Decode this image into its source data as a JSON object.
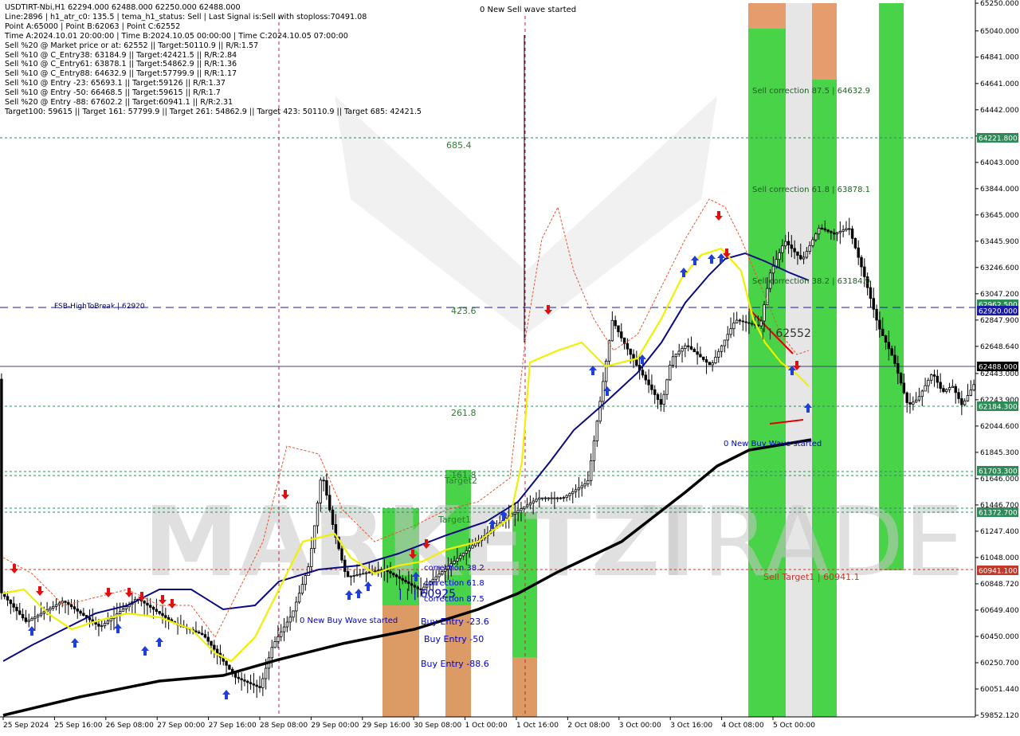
{
  "info": {
    "lines": [
      "USDTIRT-Nbi,H1  62294.000 62488.000 62250.000 62488.000",
      "Line:2896 | h1_atr_c0: 135.5 | tema_h1_status: Sell | Last Signal is:Sell with stoploss:70491.08",
      "Point A:65000 | Point B:62063 | Point C:62552",
      "Time A:2024.10.01 20:00:00 | Time B:2024.10.05 00:00:00 | Time C:2024.10.05 07:00:00",
      "Sell %20 @ Market price or at: 62552 || Target:50110.9 || R/R:1.57",
      "Sell %10 @ C_Entry38: 63184.9 || Target:42421.5 || R/R:2.84",
      "Sell %10 @ C_Entry61: 63878.1 || Target:54862.9 || R/R:1.36",
      "Sell %10 @ C_Entry88: 64632.9 || Target:57799.9 || R/R:1.17",
      "Sell %10 @ Entry -23: 65693.1 || Target:59126 || R/R:1.37",
      "Sell %10 @ Entry -50: 66468.5 || Target:59615 || R/R:1.7",
      "Sell %20 @ Entry -88: 67602.2 || Target:60941.1 || R/R:2.31",
      "Target100: 59615 || Target 161: 57799.9 || Target 261: 54862.9 || Target 423: 50110.9 || Target 685: 42421.5"
    ]
  },
  "watermark": {
    "left": "MARKETZI",
    "right": "TRADE"
  },
  "chart_data": {
    "type": "line",
    "symbol": "USDTIRT-Nbi",
    "timeframe": "H1",
    "ylim": [
      59852.12,
      65250.0
    ],
    "y_ticks": [
      "65250.000",
      "65040.000",
      "64841.000",
      "64641.000",
      "64442.000",
      "64243.000",
      "64043.000",
      "63844.000",
      "63645.000",
      "63445.900",
      "63246.600",
      "63047.200",
      "62847.900",
      "62648.640",
      "62443.000",
      "62243.900",
      "62044.600",
      "61845.300",
      "61646.000",
      "61446.700",
      "61247.400",
      "61048.000",
      "60848.720",
      "60649.400",
      "60450.000",
      "60250.700",
      "60051.440",
      "59852.120"
    ],
    "x_labels": [
      "25 Sep 2024",
      "25 Sep 16:00",
      "26 Sep 08:00",
      "27 Sep 00:00",
      "27 Sep 16:00",
      "28 Sep 08:00",
      "29 Sep 00:00",
      "29 Sep 16:00",
      "30 Sep 08:00",
      "1 Oct 00:00",
      "1 Oct 16:00",
      "2 Oct 08:00",
      "3 Oct 00:00",
      "3 Oct 16:00",
      "4 Oct 08:00",
      "5 Oct 00:00"
    ],
    "price_labels": [
      {
        "text": "64221.800",
        "color": "#2e8b57"
      },
      {
        "text": "62962.500",
        "color": "#2e8b57"
      },
      {
        "text": "62920.000",
        "color": "#1a1aa6"
      },
      {
        "text": "62488.000",
        "color": "#000000"
      },
      {
        "text": "62184.300",
        "color": "#2e8b57"
      },
      {
        "text": "61703.300",
        "color": "#2e8b57"
      },
      {
        "text": "61372.700",
        "color": "#2e8b57"
      },
      {
        "text": "60941.100",
        "color": "#c0392b"
      }
    ],
    "annotations": [
      "0 New Sell wave started",
      "685.4",
      "423.6",
      "261.8",
      "161.8",
      "Target2",
      "Target1",
      "FSB-HighToBreak | 62920",
      "Sell correction 87.5 | 64632.9",
      "Sell correction 61.8 | 63878.1",
      "Sell correction 38.2 | 63184.9",
      "| | 62552",
      "0 New Buy Wave started",
      "0 New Buy Wave started",
      "Sell Target1 | 60941.1",
      "correction 38.2",
      "correction 61.8",
      "correction 87.5",
      "| | | 60925",
      "Buy Entry -23.6",
      "Buy Entry -50",
      "Buy Entry -88.6"
    ],
    "series": [
      {
        "name": "",
        "color": "#000000"
      },
      {
        "name": "",
        "color": "#0a0a80"
      },
      {
        "name": "",
        "color": "#f0f000"
      },
      {
        "name": "",
        "color": "#e4572e"
      }
    ],
    "grid": false,
    "colors": {
      "green_zone": "#3fd13f",
      "orange_zone": "#e59866",
      "candle": "#000000",
      "up_arrow": "#1f3fd6",
      "down_arrow": "#e01010"
    }
  }
}
